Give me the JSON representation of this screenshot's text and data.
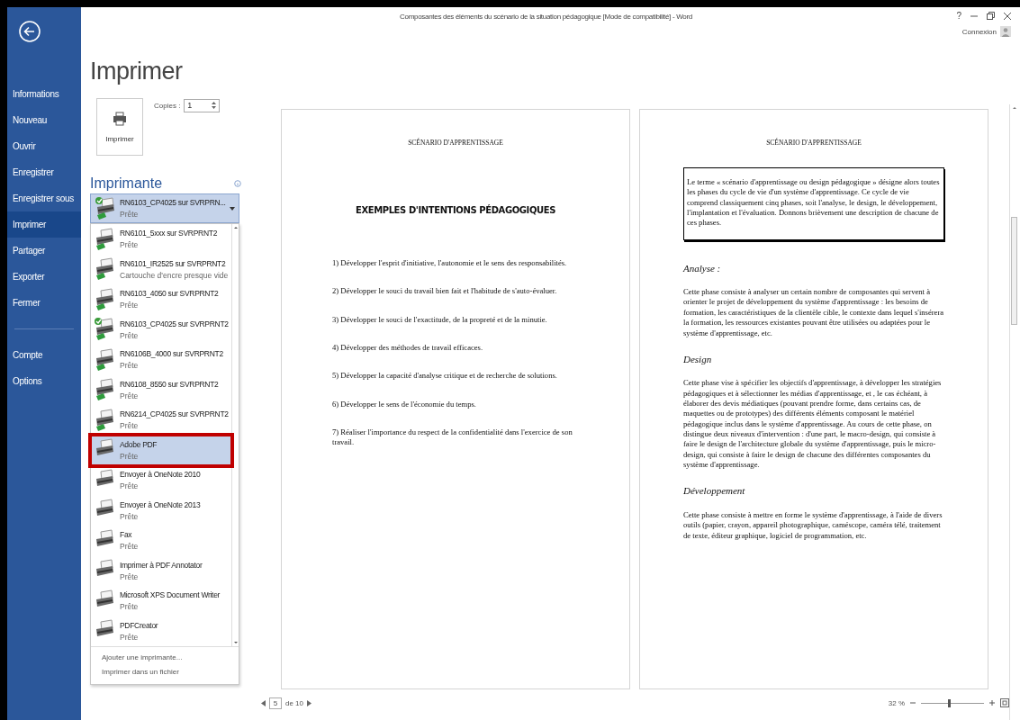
{
  "window": {
    "title": "Composantes des éléments du scénario de la situation pédagogique [Mode de compatibilité] - Word",
    "help": "?",
    "account": "Connexion"
  },
  "sidebar": {
    "items": [
      {
        "label": "Informations",
        "selected": false
      },
      {
        "label": "Nouveau",
        "selected": false
      },
      {
        "label": "Ouvrir",
        "selected": false
      },
      {
        "label": "Enregistrer",
        "selected": false
      },
      {
        "label": "Enregistrer sous",
        "selected": false
      },
      {
        "label": "Imprimer",
        "selected": true
      },
      {
        "label": "Partager",
        "selected": false
      },
      {
        "label": "Exporter",
        "selected": false
      },
      {
        "label": "Fermer",
        "selected": false
      }
    ],
    "footer_items": [
      {
        "label": "Compte",
        "selected": false
      },
      {
        "label": "Options",
        "selected": false
      }
    ]
  },
  "print": {
    "title": "Imprimer",
    "print_button": "Imprimer",
    "copies_label": "Copies :",
    "copies_value": "1",
    "printer_heading": "Imprimante",
    "current_printer": {
      "name": "RN6103_CP4025 sur SVRPRN...",
      "status": "Prête",
      "default": true,
      "network": true
    },
    "printers": [
      {
        "name": "RN6101_5xxx sur SVRPRNT2",
        "status": "Prête",
        "selected": false,
        "default": false,
        "network": true
      },
      {
        "name": "RN6101_IR2525 sur SVRPRNT2",
        "status": "Cartouche d'encre presque vide",
        "selected": false,
        "default": false,
        "network": true
      },
      {
        "name": "RN6103_4050 sur SVRPRNT2",
        "status": "Prête",
        "selected": false,
        "default": false,
        "network": true
      },
      {
        "name": "RN6103_CP4025 sur SVRPRNT2",
        "status": "Prête",
        "selected": false,
        "default": true,
        "network": true
      },
      {
        "name": "RN6106B_4000 sur SVRPRNT2",
        "status": "Prête",
        "selected": false,
        "default": false,
        "network": true
      },
      {
        "name": "RN6108_8550 sur SVRPRNT2",
        "status": "Prête",
        "selected": false,
        "default": false,
        "network": true
      },
      {
        "name": "RN6214_CP4025 sur SVRPRNT2",
        "status": "Prête",
        "selected": false,
        "default": false,
        "network": true
      },
      {
        "name": "Adobe PDF",
        "status": "Prête",
        "selected": true,
        "default": false,
        "network": false
      },
      {
        "name": "Envoyer à OneNote 2010",
        "status": "Prête",
        "selected": false,
        "default": false,
        "network": false
      },
      {
        "name": "Envoyer à OneNote 2013",
        "status": "Prête",
        "selected": false,
        "default": false,
        "network": false
      },
      {
        "name": "Fax",
        "status": "Prête",
        "selected": false,
        "default": false,
        "network": false
      },
      {
        "name": "Imprimer à PDF Annotator",
        "status": "Prête",
        "selected": false,
        "default": false,
        "network": false
      },
      {
        "name": "Microsoft XPS Document Writer",
        "status": "Prête",
        "selected": false,
        "default": false,
        "network": false
      },
      {
        "name": "PDFCreator",
        "status": "Prête",
        "selected": false,
        "default": false,
        "network": false
      }
    ],
    "actions": [
      "Ajouter une imprimante...",
      "Imprimer dans un fichier"
    ]
  },
  "preview": {
    "pages": [
      {
        "header": "SCÉNARIO D'APPRENTISSAGE",
        "blocks": [
          {
            "kind": "title",
            "text": "EXEMPLES D'INTENTIONS PÉDAGOGIQUES"
          },
          {
            "kind": "item",
            "text": "1) Développer l'esprit d'initiative, l'autonomie et le sens des responsabilités."
          },
          {
            "kind": "item",
            "text": "2) Développer le souci du travail bien fait et l'habitude de s'auto-évaluer."
          },
          {
            "kind": "item",
            "text": "3) Développer le souci de l'exactitude, de la propreté et de la minutie."
          },
          {
            "kind": "item",
            "text": "4) Développer des méthodes de travail efficaces."
          },
          {
            "kind": "item",
            "text": "5) Développer la capacité d'analyse critique et de recherche de solutions."
          },
          {
            "kind": "item",
            "text": "6) Développer le sens de l'économie du temps."
          },
          {
            "kind": "item",
            "text": "7) Réaliser l'importance du respect de la confidentialité dans l'exercice de son travail."
          }
        ]
      },
      {
        "header": "SCÉNARIO D'APPRENTISSAGE",
        "blocks": [
          {
            "kind": "box",
            "text": "Le terme « scénario d'apprentissage ou design pédagogique » désigne alors toutes les phases du cycle de vie d'un système d'apprentissage.  Ce cycle de vie comprend classiquement cinq phases, soit l'analyse, le design, le développement, l'implantation et l'évaluation.  Donnons brièvement une description de chacune de ces phases."
          },
          {
            "kind": "heading",
            "text": "Analyse :"
          },
          {
            "kind": "paragraph",
            "text": "Cette phase consiste à analyser un certain nombre de composantes qui servent à orienter le projet de développement du système d'apprentissage : les besoins de formation, les caractéristiques de la clientèle cible, le contexte dans lequel s'insérera la formation, les ressources existantes pouvant être utilisées ou adaptées pour le système d'apprentissage, etc."
          },
          {
            "kind": "heading",
            "text": "Design"
          },
          {
            "kind": "paragraph",
            "text": "Cette phase vise à spécifier les objectifs d'apprentissage, à développer les stratégies pédagogiques et à sélectionner les médias d'apprentissage, et , le cas échéant, à élaborer des devis médiatiques (pouvant prendre forme, dans certains cas, de maquettes ou de prototypes) des différents éléments composant le matériel pédagogique inclus dans le système d'apprentissage. Au cours de cette phase, on distingue deux niveaux d'intervention : d'une part, le macro-design, qui consiste à faire le design de l'architecture globale du système d'apprentissage, puis le micro-design, qui consiste à faire le design de chacune des différentes composantes du système d'apprentissage."
          },
          {
            "kind": "heading",
            "text": "Développement"
          },
          {
            "kind": "paragraph",
            "text": "Cette phase consiste à mettre en forme le système d'apprentissage, à l'aide de divers outils (papier, crayon, appareil photographique, caméscope, caméra télé, traitement de texte, éditeur graphique, logiciel de programmation, etc."
          }
        ]
      }
    ],
    "page_number": "5",
    "page_count": "de 10",
    "zoom": {
      "label": "32 %",
      "level": 0.45
    }
  }
}
